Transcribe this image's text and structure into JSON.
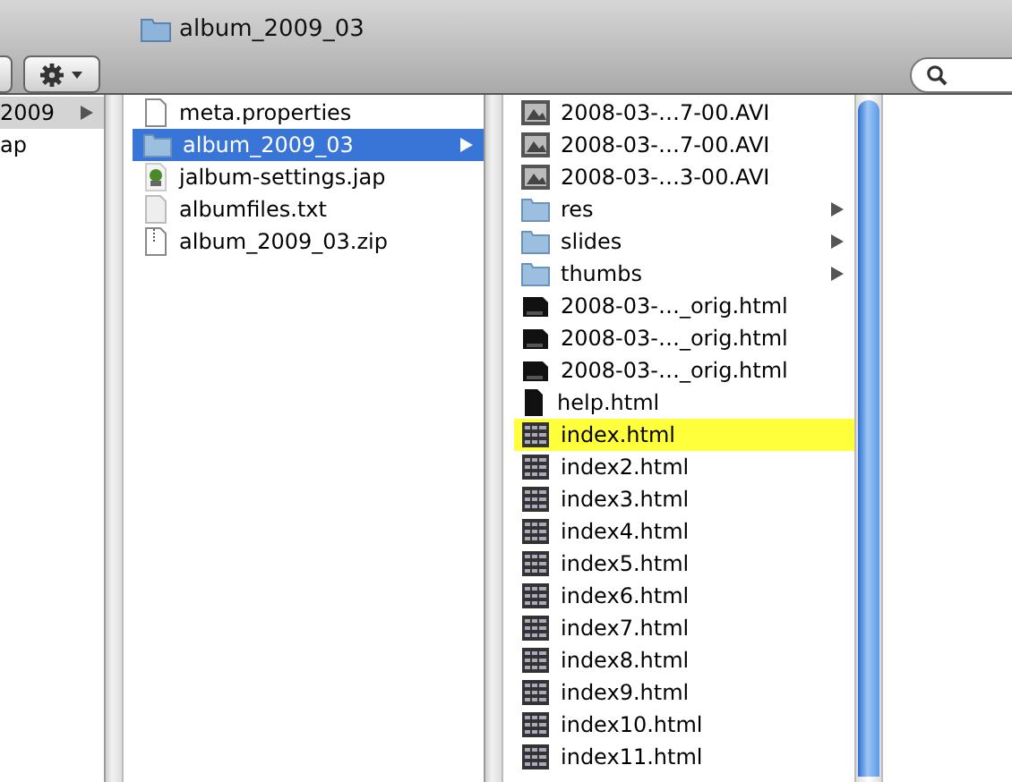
{
  "window": {
    "title": "album_2009_03"
  },
  "columns": [
    {
      "items": [
        {
          "name": "2009",
          "kind": "folder-cut",
          "selected": true,
          "has_children": true
        },
        {
          "name": "ap",
          "kind": "folder-cut",
          "selected": false,
          "has_children": false
        }
      ]
    },
    {
      "items": [
        {
          "name": "meta.properties",
          "kind": "file",
          "selected": false,
          "has_children": false
        },
        {
          "name": "album_2009_03",
          "kind": "folder",
          "selected": true,
          "has_children": true
        },
        {
          "name": "jalbum-settings.jap",
          "kind": "settings",
          "selected": false,
          "has_children": false
        },
        {
          "name": "albumfiles.txt",
          "kind": "text",
          "selected": false,
          "has_children": false
        },
        {
          "name": "album_2009_03.zip",
          "kind": "zip",
          "selected": false,
          "has_children": false
        }
      ]
    },
    {
      "items": [
        {
          "name": "2008-03-…7-00.AVI",
          "kind": "video",
          "selected": false,
          "has_children": false
        },
        {
          "name": "2008-03-…7-00.AVI",
          "kind": "video",
          "selected": false,
          "has_children": false
        },
        {
          "name": "2008-03-…3-00.AVI",
          "kind": "video",
          "selected": false,
          "has_children": false
        },
        {
          "name": "res",
          "kind": "folder",
          "selected": false,
          "has_children": true
        },
        {
          "name": "slides",
          "kind": "folder",
          "selected": false,
          "has_children": true
        },
        {
          "name": "thumbs",
          "kind": "folder",
          "selected": false,
          "has_children": true
        },
        {
          "name": "2008-03-…_orig.html",
          "kind": "dark-page",
          "selected": false,
          "has_children": false
        },
        {
          "name": "2008-03-…_orig.html",
          "kind": "dark-page",
          "selected": false,
          "has_children": false
        },
        {
          "name": "2008-03-…_orig.html",
          "kind": "dark-page",
          "selected": false,
          "has_children": false
        },
        {
          "name": "help.html",
          "kind": "black-page",
          "selected": false,
          "has_children": false
        },
        {
          "name": "index.html",
          "kind": "grid-page",
          "selected": false,
          "has_children": false,
          "color": "#ffff3c"
        },
        {
          "name": "index2.html",
          "kind": "grid-page",
          "selected": false,
          "has_children": false
        },
        {
          "name": "index3.html",
          "kind": "grid-page",
          "selected": false,
          "has_children": false
        },
        {
          "name": "index4.html",
          "kind": "grid-page",
          "selected": false,
          "has_children": false
        },
        {
          "name": "index5.html",
          "kind": "grid-page",
          "selected": false,
          "has_children": false
        },
        {
          "name": "index6.html",
          "kind": "grid-page",
          "selected": false,
          "has_children": false
        },
        {
          "name": "index7.html",
          "kind": "grid-page",
          "selected": false,
          "has_children": false
        },
        {
          "name": "index8.html",
          "kind": "grid-page",
          "selected": false,
          "has_children": false
        },
        {
          "name": "index9.html",
          "kind": "grid-page",
          "selected": false,
          "has_children": false
        },
        {
          "name": "index10.html",
          "kind": "grid-page",
          "selected": false,
          "has_children": false
        },
        {
          "name": "index11.html",
          "kind": "grid-page",
          "selected": false,
          "has_children": false
        }
      ]
    }
  ]
}
